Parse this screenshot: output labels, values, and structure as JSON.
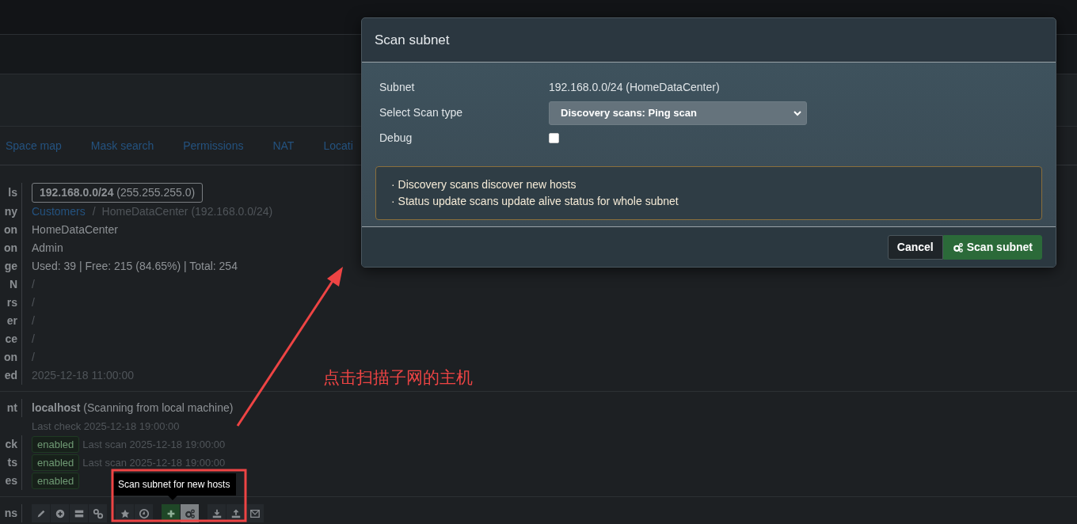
{
  "tabs": [
    {
      "label": "Space map"
    },
    {
      "label": "Mask search"
    },
    {
      "label": "Permissions"
    },
    {
      "label": "NAT"
    },
    {
      "label": "Locati"
    }
  ],
  "details": [
    {
      "label": "ls",
      "kind": "boxed",
      "value": "**192.168.0.0/24** (255.255.255.0)"
    },
    {
      "label": "ny",
      "kind": "breadcrumb",
      "link": "Customers",
      "separator": "/",
      "current": "HomeDataCenter (192.168.0.0/24)"
    },
    {
      "label": "on",
      "kind": "text",
      "value": "HomeDataCenter"
    },
    {
      "label": "on",
      "kind": "text",
      "value": "Admin"
    },
    {
      "label": "ge",
      "kind": "text",
      "value": "Used: 39 | Free: 215 (84.65%) | Total: 254"
    },
    {
      "label": "N",
      "kind": "muted",
      "value": "/"
    },
    {
      "label": "rs",
      "kind": "muted",
      "value": "/"
    },
    {
      "label": "er",
      "kind": "muted",
      "value": "/"
    },
    {
      "label": "ce",
      "kind": "muted",
      "value": "/"
    },
    {
      "label": "on",
      "kind": "muted",
      "value": "/"
    },
    {
      "label": "ed",
      "kind": "muted",
      "value": "2025-12-18 11:00:00"
    }
  ],
  "scan_details": [
    {
      "label": "nt",
      "kind": "agent",
      "value": "**localhost** (Scanning from local machine)",
      "note": "Last check 2025-12-18 19:00:00"
    },
    {
      "label": "ck",
      "kind": "status",
      "badge": "enabled",
      "note": "Last scan 2025-12-18 19:00:00"
    },
    {
      "label": "ts",
      "kind": "status",
      "badge": "enabled",
      "note": "Last scan 2025-12-18 19:00:00"
    },
    {
      "label": "es",
      "kind": "status",
      "badge": "enabled"
    }
  ],
  "actions": {
    "label": "ns",
    "groups": [
      [
        {
          "kind": "edit",
          "hovered": false
        },
        {
          "kind": "add-circle",
          "hovered": false
        },
        {
          "kind": "server",
          "hovered": false
        },
        {
          "kind": "link",
          "hovered": false
        }
      ],
      [
        {
          "kind": "star",
          "hovered": false
        },
        {
          "kind": "clock",
          "hovered": false
        }
      ],
      [
        {
          "kind": "add",
          "hovered": false
        },
        {
          "kind": "gears",
          "hovered": true
        }
      ],
      [
        {
          "kind": "download",
          "hovered": false
        },
        {
          "kind": "upload",
          "hovered": false
        },
        {
          "kind": "mail",
          "hovered": false
        }
      ]
    ]
  },
  "tooltip": "Scan subnet for new hosts",
  "annotation": "点击扫描子网的主机",
  "modal": {
    "title": "Scan subnet",
    "fields": [
      {
        "label": "Subnet",
        "kind": "text",
        "value": "192.168.0.0/24 (HomeDataCenter)"
      },
      {
        "label": "Select Scan type",
        "kind": "select",
        "value": "Discovery scans: Ping scan"
      },
      {
        "label": "Debug",
        "kind": "checkbox",
        "checked": false
      }
    ],
    "notes": [
      "· Discovery scans discover new hosts",
      "· Status update scans update alive status for whole subnet"
    ],
    "buttons": [
      {
        "label": "Cancel",
        "kind": "secondary"
      },
      {
        "label": "Scan subnet",
        "kind": "primary"
      }
    ]
  }
}
